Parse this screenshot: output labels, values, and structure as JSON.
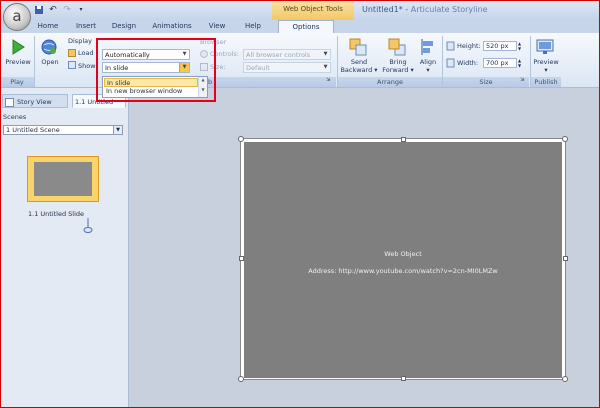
{
  "window": {
    "tools_label": "Web Object Tools",
    "document_title": "Untitled1*",
    "title_separator": " - ",
    "app_name": "Articulate Storyline",
    "orb_glyph": "a"
  },
  "tabs": [
    {
      "label": "Home"
    },
    {
      "label": "Insert"
    },
    {
      "label": "Design"
    },
    {
      "label": "Animations"
    },
    {
      "label": "View"
    },
    {
      "label": "Help"
    },
    {
      "label": "Options"
    }
  ],
  "ribbon": {
    "play": {
      "preview_label": "Preview",
      "group_label": "Play"
    },
    "open_label": "Open",
    "display": {
      "header": "Display",
      "load_label": "Load",
      "show_label": "Show",
      "load_value": "Automatically",
      "show_value": "In slide",
      "show_options": [
        "In slide",
        "In new browser window"
      ]
    },
    "browser": {
      "header": "Browser",
      "controls_label": "Controls:",
      "controls_value": "All browser controls",
      "size_label": "Size:",
      "size_value": "Default",
      "group_label_fragment": "b"
    },
    "arrange": {
      "send_backward": [
        "Send",
        "Backward"
      ],
      "bring_forward": [
        "Bring",
        "Forward"
      ],
      "align_label": "Align",
      "group_label": "Arrange"
    },
    "size": {
      "height_label": "Height:",
      "height_value": "520 px",
      "width_label": "Width:",
      "width_value": "700 px",
      "group_label": "Size"
    },
    "publish": {
      "preview_label": "Preview",
      "group_label": "Publish"
    }
  },
  "left_pane": {
    "tabs": [
      {
        "label": "Story View"
      },
      {
        "label": "1.1 Untitled"
      }
    ],
    "scenes_label": "Scenes",
    "scene_selected": "1 Untitled Scene",
    "slide_caption": "1.1 Untitled Slide"
  },
  "canvas": {
    "web_object_title": "Web Object",
    "web_object_address": "Address: http://www.youtube.com/watch?v=2cn-MI0LMZw"
  },
  "colors": {
    "accent": "#e3001b",
    "tools_tab": "#f3c766",
    "web_object_fill": "#7f7f7f"
  }
}
